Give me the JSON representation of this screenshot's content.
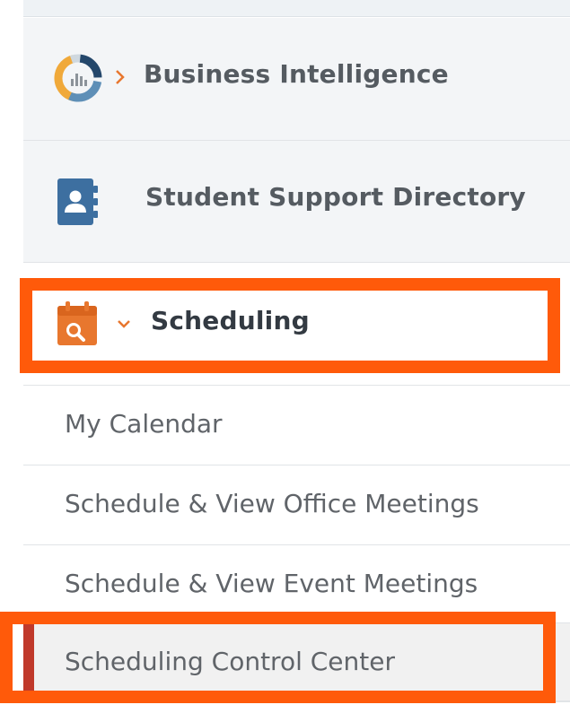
{
  "nav": {
    "items": [
      {
        "label": "Business Intelligence",
        "icon": "chart-donut-icon",
        "chevron": "chevron-right-icon"
      },
      {
        "label": "Student Support Directory",
        "icon": "contact-book-icon"
      },
      {
        "label": "Scheduling",
        "icon": "calendar-search-icon",
        "chevron": "chevron-down-icon",
        "expanded": true
      }
    ],
    "sub_items": [
      {
        "label": "My Calendar"
      },
      {
        "label": "Schedule & View Office Meetings"
      },
      {
        "label": "Schedule & View Event Meetings"
      },
      {
        "label": "Scheduling Control Center",
        "active": true
      }
    ]
  },
  "colors": {
    "highlight": "#ff5a0a",
    "accent_orange": "#e8772e",
    "active_bar": "#c0392b",
    "icon_blue": "#3d6fa0"
  }
}
